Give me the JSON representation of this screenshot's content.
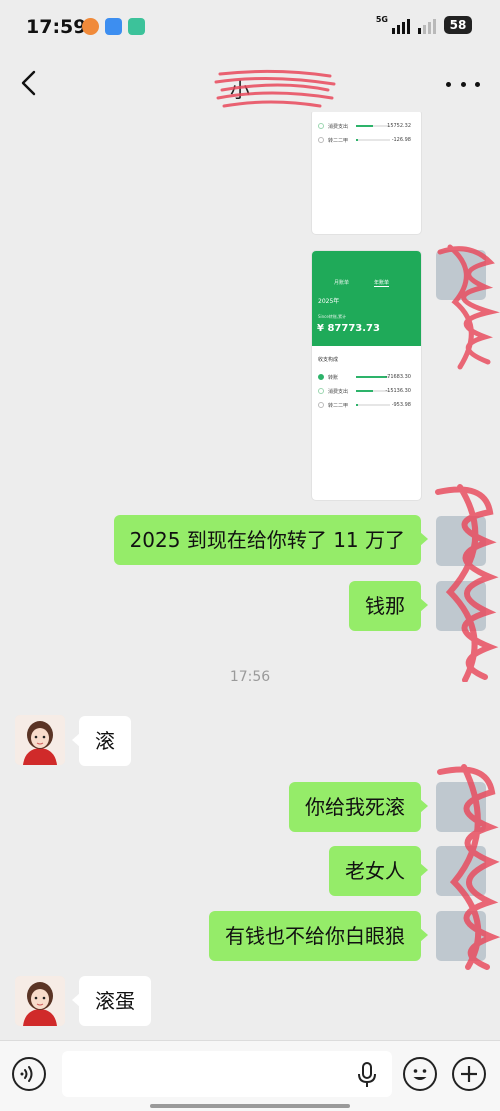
{
  "status_bar": {
    "time": "17:59",
    "network": "5G",
    "battery": "58"
  },
  "nav": {
    "contact_name": "小",
    "back_icon": "chevron-left-icon",
    "more_icon": "more-dots-icon"
  },
  "screenshot_top": {
    "rows": [
      {
        "label": "消费支出",
        "amount": "15752.32",
        "fill": 0.5
      },
      {
        "label": "转二二甲",
        "amount": "-126.98",
        "fill": 0.05
      }
    ]
  },
  "screenshot_bill": {
    "tab_left": "月账单",
    "tab_right": "年账单",
    "year": "2025年",
    "total_label": "Since转账,累计",
    "total": "¥ 87773.73",
    "section_title": "收支构成",
    "rows": [
      {
        "label": "转账",
        "amount": "-71683.30",
        "fill": 0.9
      },
      {
        "label": "消费支出",
        "amount": "-15136.30",
        "fill": 0.5
      },
      {
        "label": "转二二甲",
        "amount": "-953.98",
        "fill": 0.05
      }
    ]
  },
  "messages": {
    "m1": "2025 到现在给你转了 11 万了",
    "m2": "钱那",
    "timestamp": "17:56",
    "m3": "滚",
    "m4": "你给我死滚",
    "m5": "老女人",
    "m6": "有钱也不给你白眼狼",
    "m7": "滚蛋"
  },
  "input_bar": {
    "placeholder": "",
    "voice_icon": "voice-icon",
    "mic_icon": "microphone-icon",
    "emoji_icon": "emoji-icon",
    "plus_icon": "plus-icon"
  },
  "colors": {
    "outgoing_bubble": "#95ec69",
    "incoming_bubble": "#ffffff",
    "background": "#ededed",
    "wechat_green": "#1faa59",
    "redaction": "#e8485a"
  }
}
